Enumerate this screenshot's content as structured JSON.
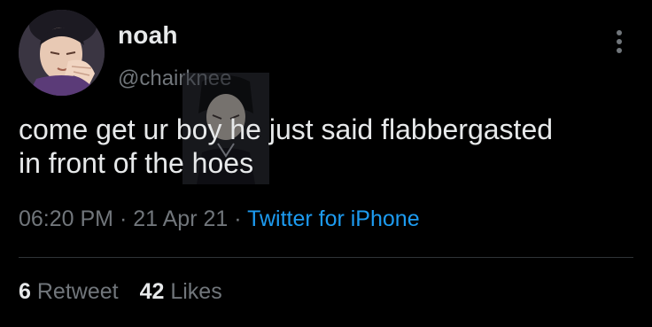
{
  "tweet": {
    "author": {
      "display_name": "noah",
      "handle": "@chairknee",
      "avatar_icon": "anime-character-avatar"
    },
    "more_icon": "more-vertical-icon",
    "text_line1": "come get ur boy he just said flabbergasted",
    "text_line2": "in front of the hoes",
    "time": "06:20 PM",
    "separator": "·",
    "date": "21 Apr 21",
    "source": "Twitter for iPhone",
    "stats": {
      "retweets_count": "6",
      "retweets_label": "Retweet",
      "likes_count": "42",
      "likes_label": "Likes"
    }
  },
  "colors": {
    "background": "#000000",
    "primary_text": "#e7e9ea",
    "secondary_text": "#71767b",
    "link": "#1d9bf0",
    "divider": "#2f3336"
  }
}
